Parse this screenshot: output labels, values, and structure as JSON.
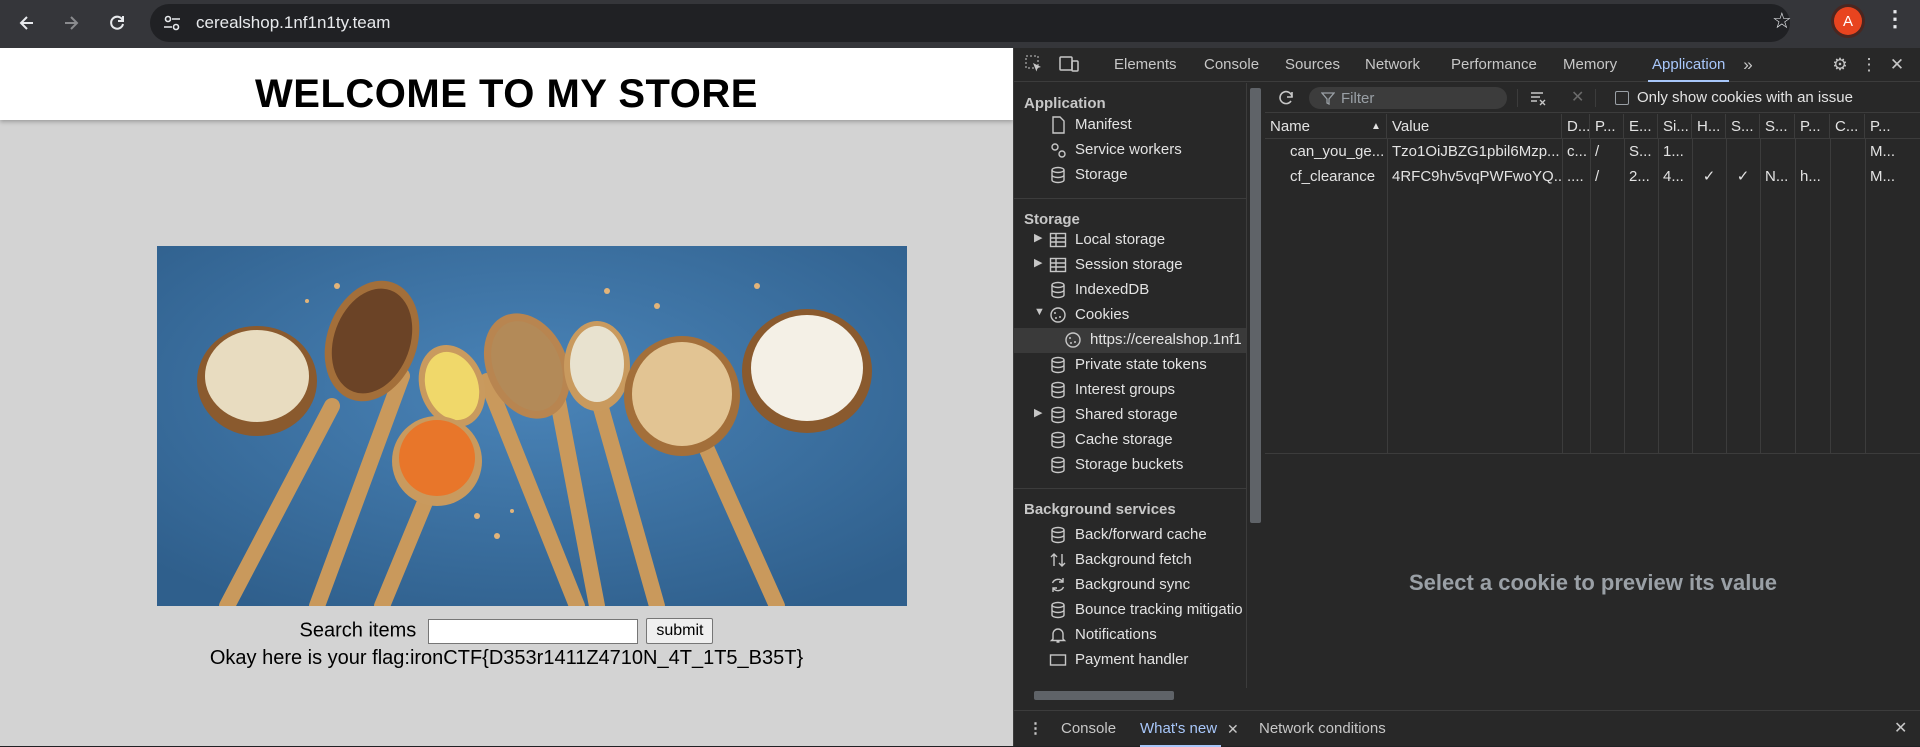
{
  "browser": {
    "url": "cerealshop.1nf1n1ty.team",
    "avatar_letter": "A"
  },
  "page": {
    "title": "WELCOME TO MY STORE",
    "search_label": "Search items",
    "search_value": "",
    "submit_label": "submit",
    "flag_text": "Okay here is your flag:ironCTF{D353r1411Z4710N_4T_1T5_B35T}"
  },
  "devtools": {
    "tabs": [
      "Elements",
      "Console",
      "Sources",
      "Network",
      "Performance",
      "Memory",
      "Application"
    ],
    "active_tab": "Application",
    "sidebar": {
      "application_header": "Application",
      "application_items": [
        "Manifest",
        "Service workers",
        "Storage"
      ],
      "storage_header": "Storage",
      "storage_items": [
        "Local storage",
        "Session storage",
        "IndexedDB",
        "Cookies",
        "https://cerealshop.1nf1",
        "Private state tokens",
        "Interest groups",
        "Shared storage",
        "Cache storage",
        "Storage buckets"
      ],
      "background_header": "Background services",
      "background_items": [
        "Back/forward cache",
        "Background fetch",
        "Background sync",
        "Bounce tracking mitigatio",
        "Notifications",
        "Payment handler"
      ]
    },
    "toolbar": {
      "filter_placeholder": "Filter",
      "only_issues_label": "Only show cookies with an issue"
    },
    "table": {
      "headers": [
        "Name",
        "Value",
        "D...",
        "P...",
        "E...",
        "Si...",
        "H...",
        "S...",
        "S...",
        "P...",
        "C...",
        "P..."
      ],
      "rows": [
        [
          "can_you_ge...",
          "Tzo1OiJBZG1pbil6Mzp...",
          "c...",
          "/",
          "S...",
          "1...",
          "",
          "",
          "",
          "",
          "",
          "M..."
        ],
        [
          "cf_clearance",
          "4RFC9hv5vqPWFwoYQ...",
          "....",
          "/",
          "2...",
          "4...",
          "✓",
          "✓",
          "N...",
          "h...",
          "",
          "M..."
        ]
      ]
    },
    "preview_text": "Select a cookie to preview its value",
    "drawer_tabs": [
      "Console",
      "What's new",
      "Network conditions"
    ],
    "drawer_active": "What's new"
  }
}
